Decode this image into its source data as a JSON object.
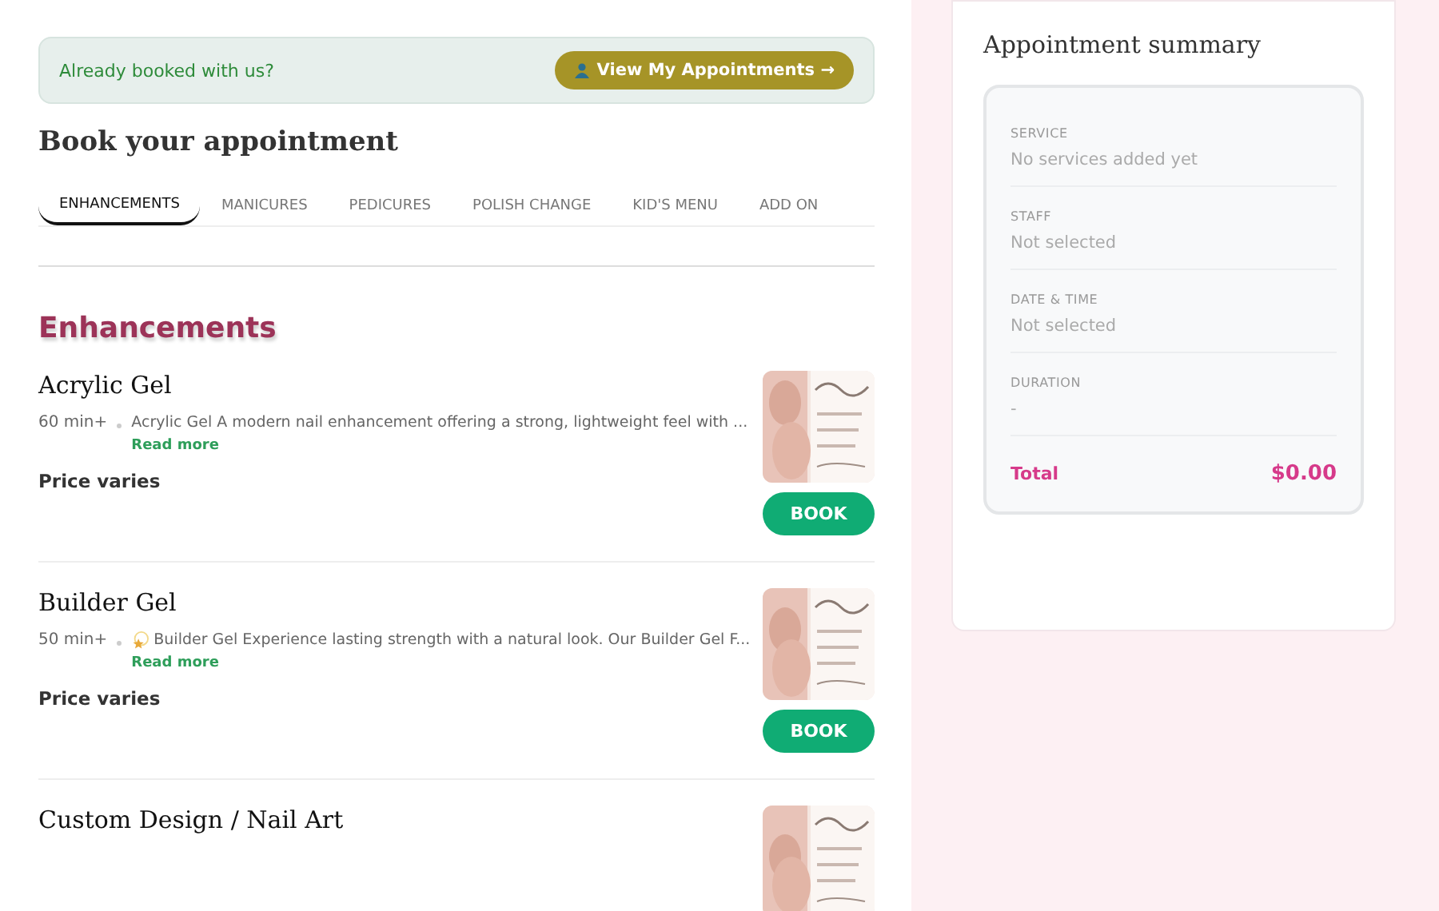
{
  "banner": {
    "text": "Already booked with us?",
    "button": "View My Appointments →"
  },
  "heading": "Book your appointment",
  "tabs": [
    {
      "label": "ENHANCEMENTS",
      "selected": true
    },
    {
      "label": "MANICURES",
      "selected": false
    },
    {
      "label": "PEDICURES",
      "selected": false
    },
    {
      "label": "POLISH CHANGE",
      "selected": false
    },
    {
      "label": "KID'S MENU",
      "selected": false
    },
    {
      "label": "ADD ON",
      "selected": false
    }
  ],
  "section_title": "Enhancements",
  "services": [
    {
      "name": "Acrylic Gel",
      "duration": "60 min+",
      "sparkle": false,
      "description": "Acrylic Gel A modern nail enhancement offering a strong, lightweight feel with ...",
      "read_more": "Read more",
      "price": "Price varies",
      "button": "BOOK"
    },
    {
      "name": "Builder Gel",
      "duration": "50 min+",
      "sparkle": true,
      "description": "Builder Gel Experience lasting strength with a natural look. Our Builder Gel F...",
      "read_more": "Read more",
      "price": "Price varies",
      "button": "BOOK"
    },
    {
      "name": "Custom Design / Nail Art"
    }
  ],
  "summary": {
    "title": "Appointment summary",
    "rows": [
      {
        "label": "SERVICE",
        "value": "No services added yet"
      },
      {
        "label": "STAFF",
        "value": "Not selected"
      },
      {
        "label": "DATE & TIME",
        "value": "Not selected"
      },
      {
        "label": "DURATION",
        "value": "-"
      }
    ],
    "total_label": "Total",
    "total": "$0.00"
  }
}
